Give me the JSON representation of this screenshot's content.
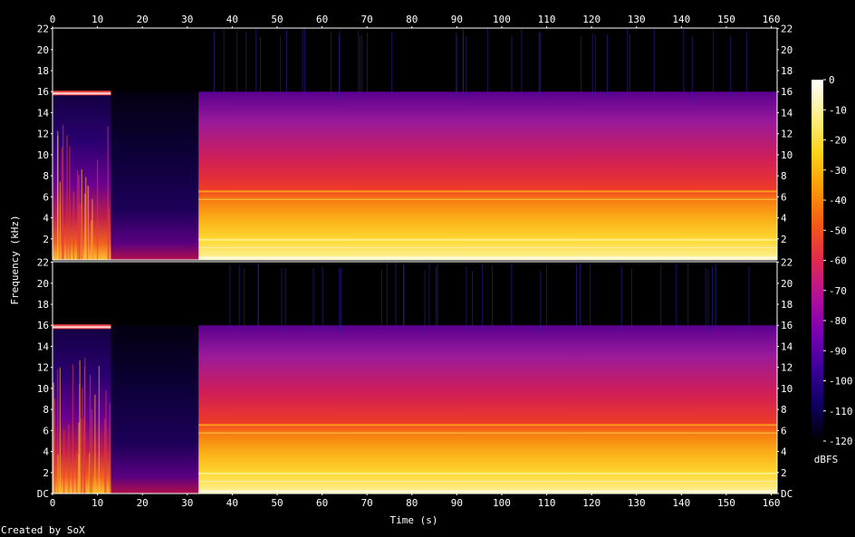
{
  "chart_data": {
    "type": "heatmap",
    "xlabel": "Time (s)",
    "ylabel": "Frequency (kHz)",
    "xlim": [
      0,
      161.3
    ],
    "x_ticks": [
      0,
      10,
      20,
      30,
      40,
      50,
      60,
      70,
      80,
      90,
      100,
      110,
      120,
      130,
      140,
      150,
      160
    ],
    "channels": [
      {
        "ylim": [
          0,
          22.05
        ],
        "y_ticks": [
          "22",
          "20",
          "18",
          "16",
          "14",
          "12",
          "10",
          "8",
          "6",
          "4",
          "2"
        ],
        "y_tick_values": [
          22,
          20,
          18,
          16,
          14,
          12,
          10,
          8,
          6,
          4,
          2
        ]
      },
      {
        "ylim": [
          0,
          22.05
        ],
        "y_ticks": [
          "22",
          "20",
          "18",
          "16",
          "14",
          "12",
          "10",
          "8",
          "6",
          "4",
          "2",
          "DC"
        ],
        "y_tick_values": [
          22,
          20,
          18,
          16,
          14,
          12,
          10,
          8,
          6,
          4,
          2,
          0
        ]
      }
    ],
    "segments": [
      {
        "t_start": 0,
        "t_end": 13,
        "max_freq_khz": 16
      },
      {
        "t_start": 13,
        "t_end": 32.5,
        "max_freq_khz": 16
      },
      {
        "t_start": 32.5,
        "t_end": 161.3,
        "max_freq_khz": 16
      }
    ],
    "colorbar": {
      "label": "dBFS",
      "range": [
        -120,
        0
      ],
      "ticks": [
        0,
        -10,
        -20,
        -30,
        -40,
        -50,
        -60,
        -70,
        -80,
        -90,
        -100,
        -110,
        -120
      ],
      "colors": [
        "#000000",
        "#0d0060",
        "#3c0098",
        "#7a00b4",
        "#b4109a",
        "#e02a4e",
        "#f55a16",
        "#fb9a08",
        "#fdd21c",
        "#fff08a",
        "#ffffff"
      ]
    }
  },
  "footer": "Created by SoX"
}
